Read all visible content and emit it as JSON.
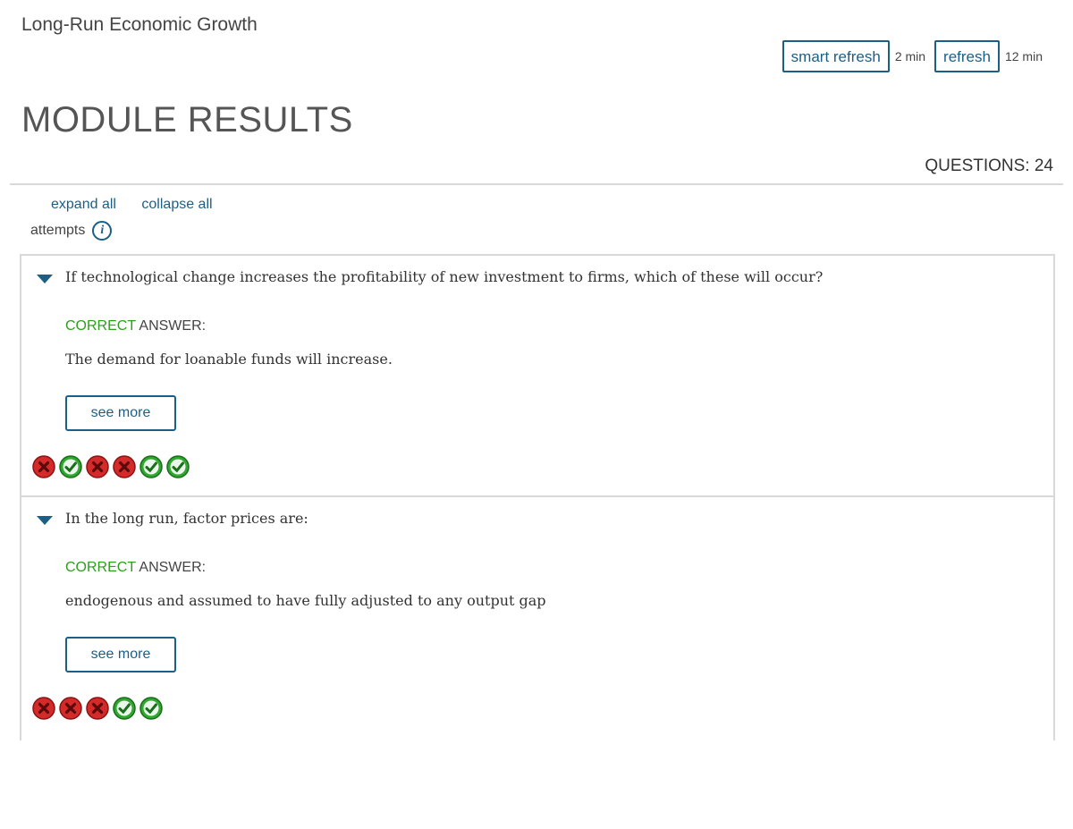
{
  "header": {
    "course_title": "Long-Run Economic Growth",
    "smart_refresh_label": "smart refresh",
    "smart_refresh_time": "2 min",
    "refresh_label": "refresh",
    "refresh_time": "12 min"
  },
  "module": {
    "title": "MODULE RESULTS",
    "questions_count": "QUESTIONS: 24"
  },
  "controls": {
    "expand_all": "expand all",
    "collapse_all": "collapse all",
    "attempts_label": "attempts",
    "info_glyph": "i"
  },
  "colors": {
    "accent": "#1c5f86",
    "correct": "#2ca01c",
    "attempt_wrong": "#d42a2a",
    "attempt_right": "#2ea82e"
  },
  "questions": [
    {
      "text": "If technological change increases the profitability of new investment to firms, which of these will occur?",
      "correct_label": "CORRECT",
      "answer_label": " ANSWER:",
      "answer": "The demand for loanable funds will increase.",
      "see_more_label": "see more",
      "attempts": [
        "wrong",
        "right",
        "wrong",
        "wrong",
        "right",
        "right"
      ]
    },
    {
      "text": "In the long run, factor prices are:",
      "correct_label": "CORRECT",
      "answer_label": " ANSWER:",
      "answer": "endogenous and assumed to have fully adjusted to any output gap",
      "see_more_label": "see more",
      "attempts": [
        "wrong",
        "wrong",
        "wrong",
        "right",
        "right"
      ]
    }
  ]
}
